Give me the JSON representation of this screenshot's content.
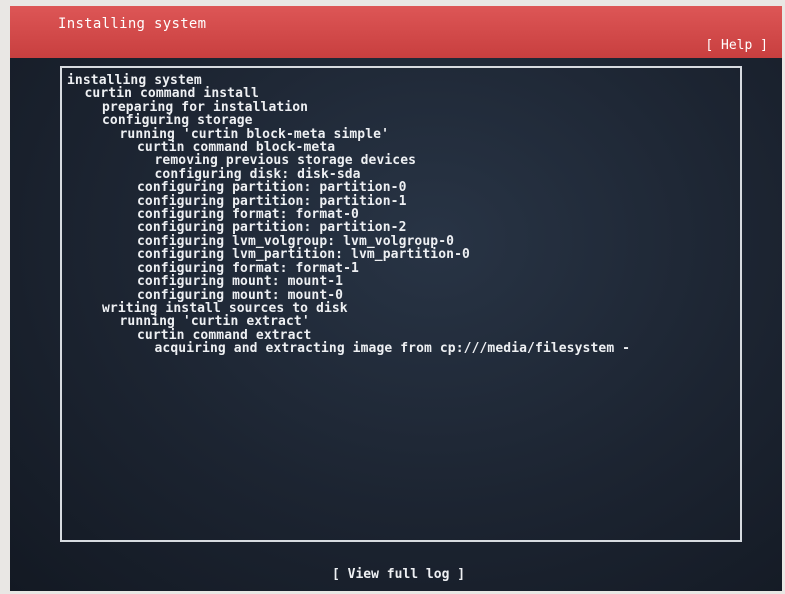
{
  "header": {
    "title": "Installing system",
    "help_label": "[ Help ]"
  },
  "log": [
    {
      "indent": 0,
      "text": "installing system"
    },
    {
      "indent": 1,
      "text": "curtin command install"
    },
    {
      "indent": 2,
      "text": "preparing for installation"
    },
    {
      "indent": 2,
      "text": "configuring storage"
    },
    {
      "indent": 3,
      "text": "running 'curtin block-meta simple'"
    },
    {
      "indent": 4,
      "text": "curtin command block-meta"
    },
    {
      "indent": 5,
      "text": "removing previous storage devices"
    },
    {
      "indent": 5,
      "text": "configuring disk: disk-sda"
    },
    {
      "indent": 4,
      "text": "configuring partition: partition-0"
    },
    {
      "indent": 4,
      "text": "configuring partition: partition-1"
    },
    {
      "indent": 4,
      "text": "configuring format: format-0"
    },
    {
      "indent": 4,
      "text": "configuring partition: partition-2"
    },
    {
      "indent": 4,
      "text": "configuring lvm_volgroup: lvm_volgroup-0"
    },
    {
      "indent": 4,
      "text": "configuring lvm_partition: lvm_partition-0"
    },
    {
      "indent": 4,
      "text": "configuring format: format-1"
    },
    {
      "indent": 4,
      "text": "configuring mount: mount-1"
    },
    {
      "indent": 4,
      "text": "configuring mount: mount-0"
    },
    {
      "indent": 2,
      "text": "writing install sources to disk"
    },
    {
      "indent": 3,
      "text": "running 'curtin extract'"
    },
    {
      "indent": 4,
      "text": "curtin command extract"
    },
    {
      "indent": 5,
      "text": "acquiring and extracting image from cp:///media/filesystem -"
    }
  ],
  "footer": {
    "view_log_label": "[ View full log ]"
  }
}
